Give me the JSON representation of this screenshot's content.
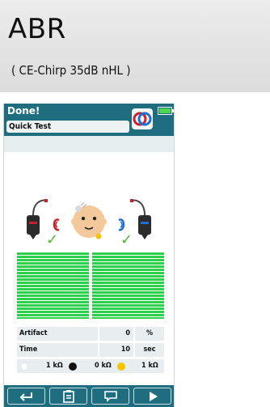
{
  "title": {
    "main": "ABR",
    "sub": "( CE-Chirp 35dB nHL )"
  },
  "device": {
    "status": "Done!",
    "test_name": "Quick Test",
    "results": {
      "left_ear_pass": true,
      "right_ear_pass": true
    },
    "stats": {
      "artifact": {
        "label": "Artifact",
        "value": "0",
        "unit": "%"
      },
      "time": {
        "label": "Time",
        "value": "10",
        "unit": "sec"
      }
    },
    "impedance": {
      "left": "1 kΩ",
      "ground": "0 kΩ",
      "right": "1 kΩ"
    },
    "colors": {
      "header": "#1f6e80",
      "pass": "#4cb830",
      "bars": "#2ecf4a",
      "left_ear": "#c8202c",
      "right_ear": "#1e6fd0"
    },
    "footer_icons": [
      "back-arrow-icon",
      "clipboard-icon",
      "comment-icon",
      "play-icon"
    ]
  }
}
